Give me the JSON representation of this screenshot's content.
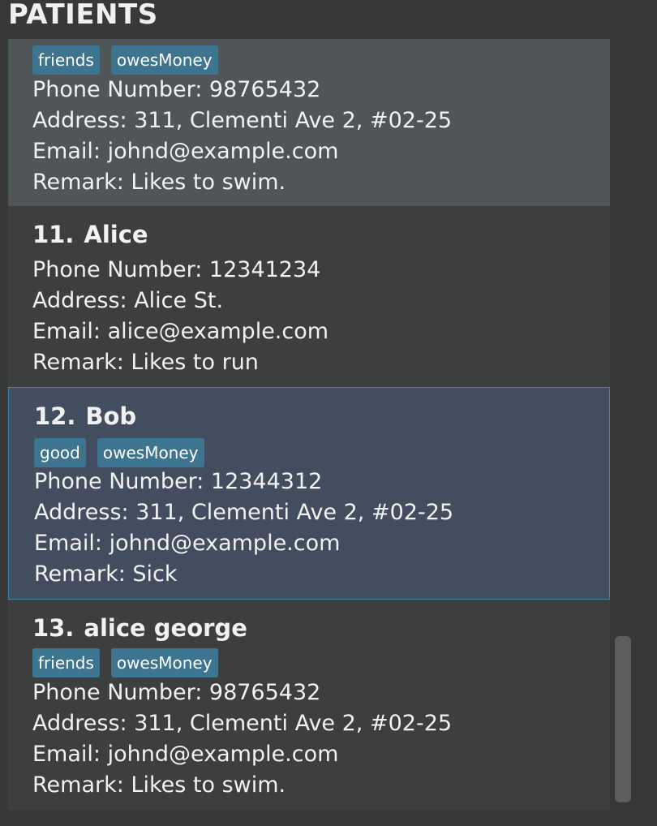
{
  "panel": {
    "title": "PATIENTS"
  },
  "patients": [
    {
      "tags": [
        "friends",
        "owesMoney"
      ],
      "phone": "Phone Number: 98765432",
      "address": "Address: 311, Clementi Ave 2, #02-25",
      "email": "Email: johnd@example.com",
      "remark": "Remark: Likes to swim."
    },
    {
      "index": "11.",
      "name": "Alice",
      "phone": "Phone Number: 12341234",
      "address": "Address: Alice St.",
      "email": "Email: alice@example.com",
      "remark": "Remark: Likes to run"
    },
    {
      "index": "12.",
      "name": "Bob",
      "tags": [
        "good",
        "owesMoney"
      ],
      "phone": "Phone Number: 12344312",
      "address": "Address: 311, Clementi Ave 2, #02-25",
      "email": "Email: johnd@example.com",
      "remark": "Remark: Sick"
    },
    {
      "index": "13.",
      "name": "alice george",
      "tags": [
        "friends",
        "owesMoney"
      ],
      "phone": "Phone Number: 98765432",
      "address": "Address: 311, Clementi Ave 2, #02-25",
      "email": "Email: johnd@example.com",
      "remark": "Remark: Likes to swim."
    }
  ],
  "colors": {
    "background": "#383838",
    "card_even": "#505558",
    "card_odd": "#3c3e3f",
    "card_selected": "#424e5f",
    "selected_border": "#3c8aa6",
    "tag": "#3d7590",
    "text": "#f2f2f2"
  }
}
